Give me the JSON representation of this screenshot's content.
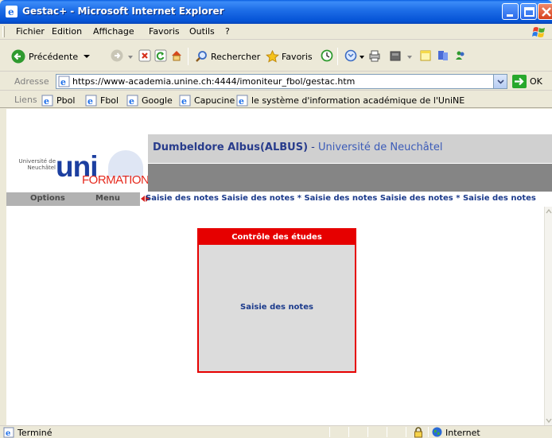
{
  "window": {
    "title": "Gestac+ - Microsoft Internet Explorer"
  },
  "menu": [
    "Fichier",
    "Edition",
    "Affichage",
    "Favoris",
    "Outils",
    "?"
  ],
  "toolbar": {
    "back_label": "Précédente",
    "search_label": "Rechercher",
    "favorites_label": "Favoris"
  },
  "address": {
    "label": "Adresse",
    "url": "https://www-academia.unine.ch:4444/imoniteur_fbol/gestac.htm",
    "go_label": "OK"
  },
  "links": {
    "label": "Liens",
    "items": [
      "Pbol",
      "Fbol",
      "Google",
      "Capucine",
      "le système d'information académique de l'UniNE"
    ]
  },
  "page": {
    "logo_small": "Université de Neuchâtel",
    "logo_big": "uni",
    "logo_sub": "FORMATION",
    "user_name": "Dumbeldore Albus(ALBUS)",
    "user_sep": " - ",
    "user_university": "Université de Neuchâtel",
    "nav_options": "Options",
    "nav_menu": "Menu",
    "marquee": "Saisie des notes Saisie des notes * Saisie des notes Saisie des notes * Saisie des notes",
    "panel_title": "Contrôle des études",
    "panel_link": "Saisie des notes"
  },
  "status": {
    "text": "Terminé",
    "zone": "Internet"
  },
  "colors": {
    "panel_red": "#e60000",
    "title_blue": "#0553d6",
    "link_blue": "#1c3b8c"
  }
}
